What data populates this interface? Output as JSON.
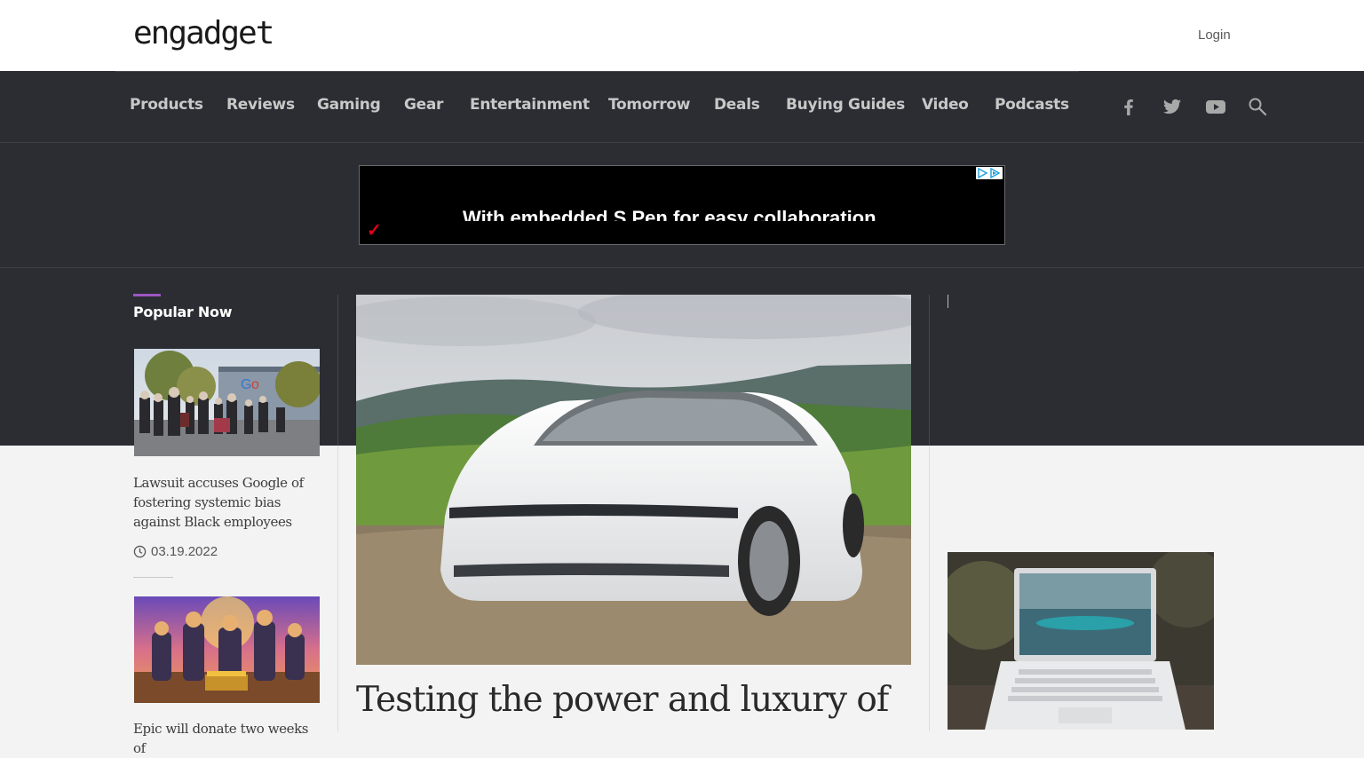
{
  "header": {
    "logo": "engadget",
    "login_label": "Login"
  },
  "nav": {
    "items": [
      {
        "label": "Products"
      },
      {
        "label": "Reviews"
      },
      {
        "label": "Gaming"
      },
      {
        "label": "Gear"
      },
      {
        "label": "Entertainment"
      },
      {
        "label": "Tomorrow"
      },
      {
        "label": "Deals"
      },
      {
        "label": "Buying Guides"
      },
      {
        "label": "Video"
      },
      {
        "label": "Podcasts"
      }
    ],
    "icons": [
      "facebook-icon",
      "twitter-icon",
      "youtube-icon",
      "search-icon"
    ]
  },
  "ad": {
    "text": "With embedded S Pen for easy collaboration"
  },
  "popular": {
    "title": "Popular Now",
    "stories": [
      {
        "title": "Lawsuit accuses Google of fostering systemic bias against Black employees",
        "date": "03.19.2022"
      },
      {
        "title": "Epic will donate two weeks of"
      }
    ]
  },
  "hero": {
    "title": "Testing the power and luxury of"
  },
  "colors": {
    "dark_bg": "#2b2d33",
    "accent": "#9d57c2",
    "light_bg": "#f3f3f3"
  }
}
